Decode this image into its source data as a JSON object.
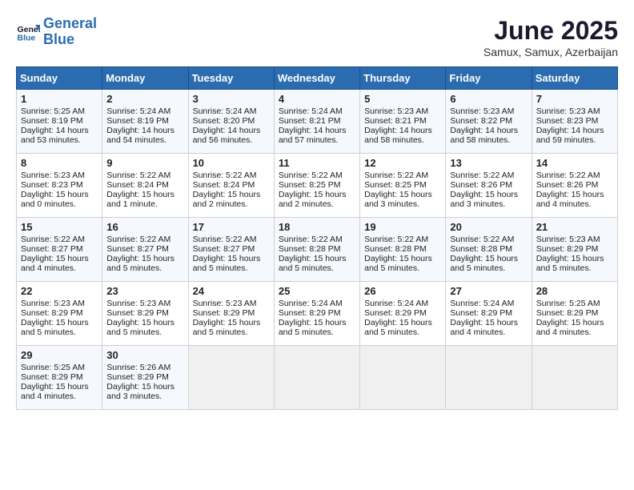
{
  "header": {
    "logo_line1": "General",
    "logo_line2": "Blue",
    "month_title": "June 2025",
    "subtitle": "Samux, Samux, Azerbaijan"
  },
  "days_of_week": [
    "Sunday",
    "Monday",
    "Tuesday",
    "Wednesday",
    "Thursday",
    "Friday",
    "Saturday"
  ],
  "weeks": [
    [
      {
        "day": "1",
        "info": "Sunrise: 5:25 AM\nSunset: 8:19 PM\nDaylight: 14 hours\nand 53 minutes."
      },
      {
        "day": "2",
        "info": "Sunrise: 5:24 AM\nSunset: 8:19 PM\nDaylight: 14 hours\nand 54 minutes."
      },
      {
        "day": "3",
        "info": "Sunrise: 5:24 AM\nSunset: 8:20 PM\nDaylight: 14 hours\nand 56 minutes."
      },
      {
        "day": "4",
        "info": "Sunrise: 5:24 AM\nSunset: 8:21 PM\nDaylight: 14 hours\nand 57 minutes."
      },
      {
        "day": "5",
        "info": "Sunrise: 5:23 AM\nSunset: 8:21 PM\nDaylight: 14 hours\nand 58 minutes."
      },
      {
        "day": "6",
        "info": "Sunrise: 5:23 AM\nSunset: 8:22 PM\nDaylight: 14 hours\nand 58 minutes."
      },
      {
        "day": "7",
        "info": "Sunrise: 5:23 AM\nSunset: 8:23 PM\nDaylight: 14 hours\nand 59 minutes."
      }
    ],
    [
      {
        "day": "8",
        "info": "Sunrise: 5:23 AM\nSunset: 8:23 PM\nDaylight: 15 hours\nand 0 minutes."
      },
      {
        "day": "9",
        "info": "Sunrise: 5:22 AM\nSunset: 8:24 PM\nDaylight: 15 hours\nand 1 minute."
      },
      {
        "day": "10",
        "info": "Sunrise: 5:22 AM\nSunset: 8:24 PM\nDaylight: 15 hours\nand 2 minutes."
      },
      {
        "day": "11",
        "info": "Sunrise: 5:22 AM\nSunset: 8:25 PM\nDaylight: 15 hours\nand 2 minutes."
      },
      {
        "day": "12",
        "info": "Sunrise: 5:22 AM\nSunset: 8:25 PM\nDaylight: 15 hours\nand 3 minutes."
      },
      {
        "day": "13",
        "info": "Sunrise: 5:22 AM\nSunset: 8:26 PM\nDaylight: 15 hours\nand 3 minutes."
      },
      {
        "day": "14",
        "info": "Sunrise: 5:22 AM\nSunset: 8:26 PM\nDaylight: 15 hours\nand 4 minutes."
      }
    ],
    [
      {
        "day": "15",
        "info": "Sunrise: 5:22 AM\nSunset: 8:27 PM\nDaylight: 15 hours\nand 4 minutes."
      },
      {
        "day": "16",
        "info": "Sunrise: 5:22 AM\nSunset: 8:27 PM\nDaylight: 15 hours\nand 5 minutes."
      },
      {
        "day": "17",
        "info": "Sunrise: 5:22 AM\nSunset: 8:27 PM\nDaylight: 15 hours\nand 5 minutes."
      },
      {
        "day": "18",
        "info": "Sunrise: 5:22 AM\nSunset: 8:28 PM\nDaylight: 15 hours\nand 5 minutes."
      },
      {
        "day": "19",
        "info": "Sunrise: 5:22 AM\nSunset: 8:28 PM\nDaylight: 15 hours\nand 5 minutes."
      },
      {
        "day": "20",
        "info": "Sunrise: 5:22 AM\nSunset: 8:28 PM\nDaylight: 15 hours\nand 5 minutes."
      },
      {
        "day": "21",
        "info": "Sunrise: 5:23 AM\nSunset: 8:29 PM\nDaylight: 15 hours\nand 5 minutes."
      }
    ],
    [
      {
        "day": "22",
        "info": "Sunrise: 5:23 AM\nSunset: 8:29 PM\nDaylight: 15 hours\nand 5 minutes."
      },
      {
        "day": "23",
        "info": "Sunrise: 5:23 AM\nSunset: 8:29 PM\nDaylight: 15 hours\nand 5 minutes."
      },
      {
        "day": "24",
        "info": "Sunrise: 5:23 AM\nSunset: 8:29 PM\nDaylight: 15 hours\nand 5 minutes."
      },
      {
        "day": "25",
        "info": "Sunrise: 5:24 AM\nSunset: 8:29 PM\nDaylight: 15 hours\nand 5 minutes."
      },
      {
        "day": "26",
        "info": "Sunrise: 5:24 AM\nSunset: 8:29 PM\nDaylight: 15 hours\nand 5 minutes."
      },
      {
        "day": "27",
        "info": "Sunrise: 5:24 AM\nSunset: 8:29 PM\nDaylight: 15 hours\nand 4 minutes."
      },
      {
        "day": "28",
        "info": "Sunrise: 5:25 AM\nSunset: 8:29 PM\nDaylight: 15 hours\nand 4 minutes."
      }
    ],
    [
      {
        "day": "29",
        "info": "Sunrise: 5:25 AM\nSunset: 8:29 PM\nDaylight: 15 hours\nand 4 minutes."
      },
      {
        "day": "30",
        "info": "Sunrise: 5:26 AM\nSunset: 8:29 PM\nDaylight: 15 hours\nand 3 minutes."
      },
      {
        "day": "",
        "info": ""
      },
      {
        "day": "",
        "info": ""
      },
      {
        "day": "",
        "info": ""
      },
      {
        "day": "",
        "info": ""
      },
      {
        "day": "",
        "info": ""
      }
    ]
  ]
}
